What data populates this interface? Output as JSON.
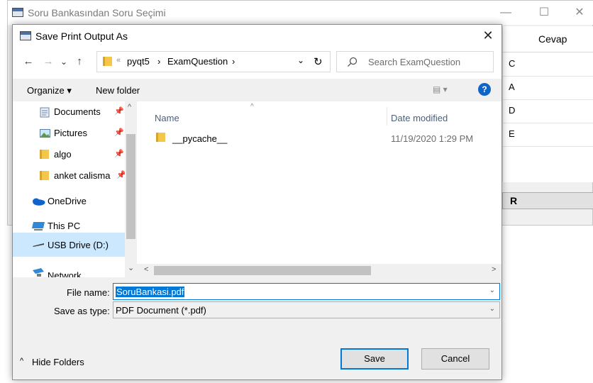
{
  "background_window": {
    "title": "Soru Bankasından Soru Seçimi",
    "controls": {
      "minimize": "—",
      "maximize": "☐",
      "close": "✕"
    },
    "table": {
      "column_header": "Cevap",
      "rows": [
        "C",
        "A",
        "D",
        "E"
      ]
    },
    "button_label": "R"
  },
  "dialog": {
    "title": "Save Print Output As",
    "close": "✕",
    "nav": {
      "back": "←",
      "forward": "→",
      "recent": "⌄",
      "up": "↑",
      "refresh": "↻"
    },
    "address": {
      "overflow": "«",
      "segments": [
        "pyqt5",
        "ExamQuestion"
      ],
      "separator": "›",
      "dropdown": "⌄"
    },
    "search": {
      "placeholder": "Search ExamQuestion",
      "icon": "search-icon"
    },
    "commandbar": {
      "organize": "Organize ▾",
      "new_folder": "New folder",
      "view": "▤ ▾",
      "help": "?"
    },
    "nav_pane": [
      {
        "label": "Documents",
        "icon": "documents-icon",
        "pinned": true
      },
      {
        "label": "Pictures",
        "icon": "pictures-icon",
        "pinned": true
      },
      {
        "label": "algo",
        "icon": "folder-icon",
        "pinned": true
      },
      {
        "label": "anket calisma",
        "icon": "folder-icon",
        "pinned": true
      },
      {
        "label": "OneDrive",
        "icon": "onedrive-icon",
        "pinned": false
      },
      {
        "label": "This PC",
        "icon": "this-pc-icon",
        "pinned": false
      },
      {
        "label": "USB Drive (D:)",
        "icon": "usb-drive-icon",
        "pinned": false,
        "selected": true
      },
      {
        "label": "Network",
        "icon": "network-icon",
        "pinned": false
      }
    ],
    "pin_glyph": "📌",
    "columns": {
      "name": "Name",
      "date_modified": "Date modified",
      "sort_indicator": "^"
    },
    "files": [
      {
        "name": "__pycache__",
        "date_modified": "11/19/2020 1:29 PM",
        "type": "folder"
      }
    ],
    "scroll": {
      "up": "^",
      "down": "⌄",
      "left": "<",
      "right": ">"
    },
    "form": {
      "file_name_label": "File name:",
      "file_name_value": "SoruBankasi.pdf",
      "save_as_type_label": "Save as type:",
      "save_as_type_value": "PDF Document (*.pdf)",
      "dropdown": "⌄"
    },
    "hide_folders": "Hide Folders",
    "hide_folders_glyph": "^",
    "buttons": {
      "save": "Save",
      "cancel": "Cancel"
    }
  },
  "colors": {
    "selection": "#0078d7",
    "help": "#0f64c8",
    "folder": "#f4c64a",
    "save_border": "#0078d7"
  }
}
